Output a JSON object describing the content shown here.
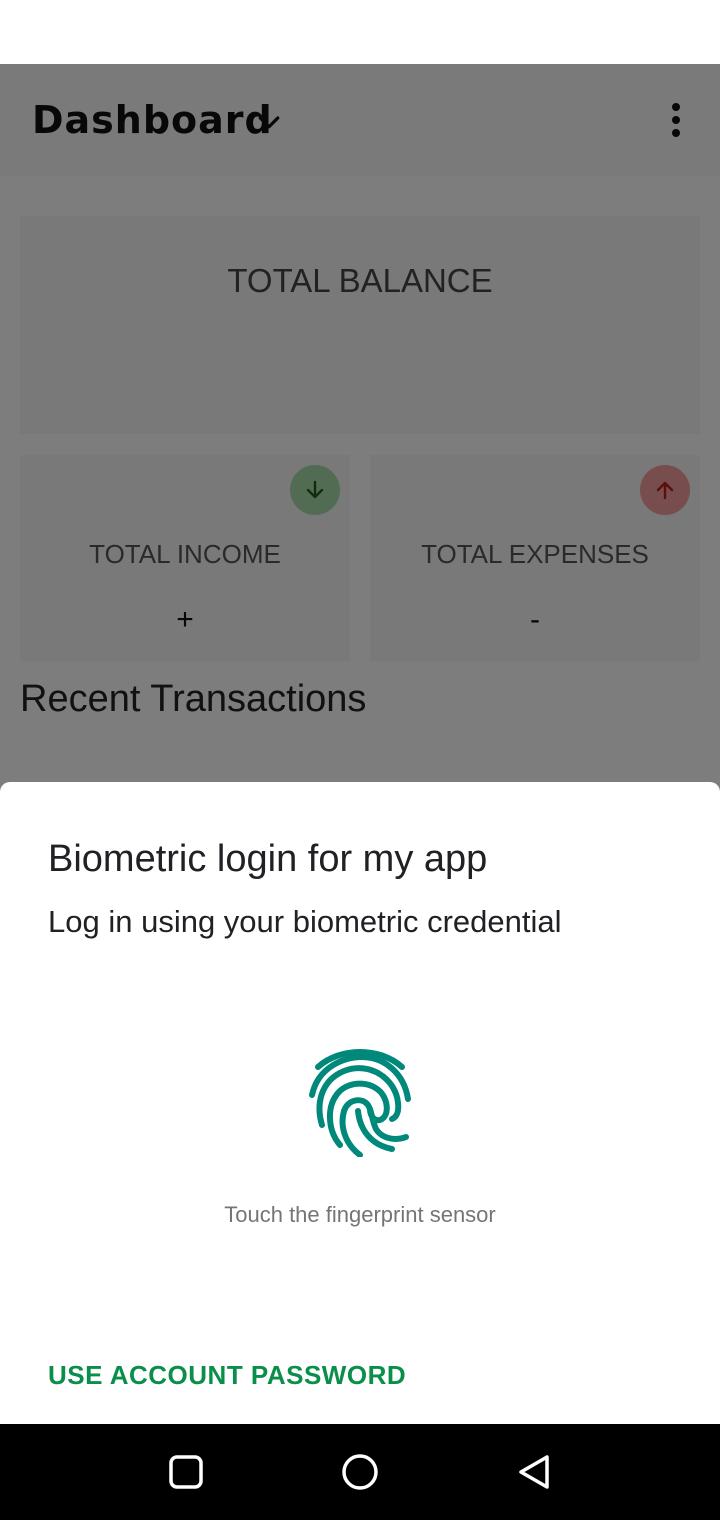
{
  "toolbar": {
    "title": "Dashboard",
    "dropdown_icon": "chevron-down-icon",
    "menu_icon": "more-vert-icon"
  },
  "dashboard": {
    "balance_label": "TOTAL BALANCE",
    "income": {
      "label": "TOTAL INCOME",
      "value": "+",
      "icon": "arrow-down-icon"
    },
    "expenses": {
      "label": "TOTAL EXPENSES",
      "value": "-",
      "icon": "arrow-up-icon"
    },
    "recent_title": "Recent Transactions"
  },
  "biometric_prompt": {
    "title": "Biometric login for my app",
    "subtitle": "Log in using your biometric credential",
    "icon": "fingerprint-icon",
    "hint": "Touch the fingerprint sensor",
    "negative_button": "USE ACCOUNT PASSWORD"
  },
  "nav": {
    "recents_icon": "recents-square-icon",
    "home_icon": "home-circle-icon",
    "back_icon": "back-triangle-icon"
  },
  "colors": {
    "accent": "#0a8f4a",
    "fingerprint": "#00897b",
    "income": "#a5d6a7",
    "expense": "#ef9a9a"
  }
}
